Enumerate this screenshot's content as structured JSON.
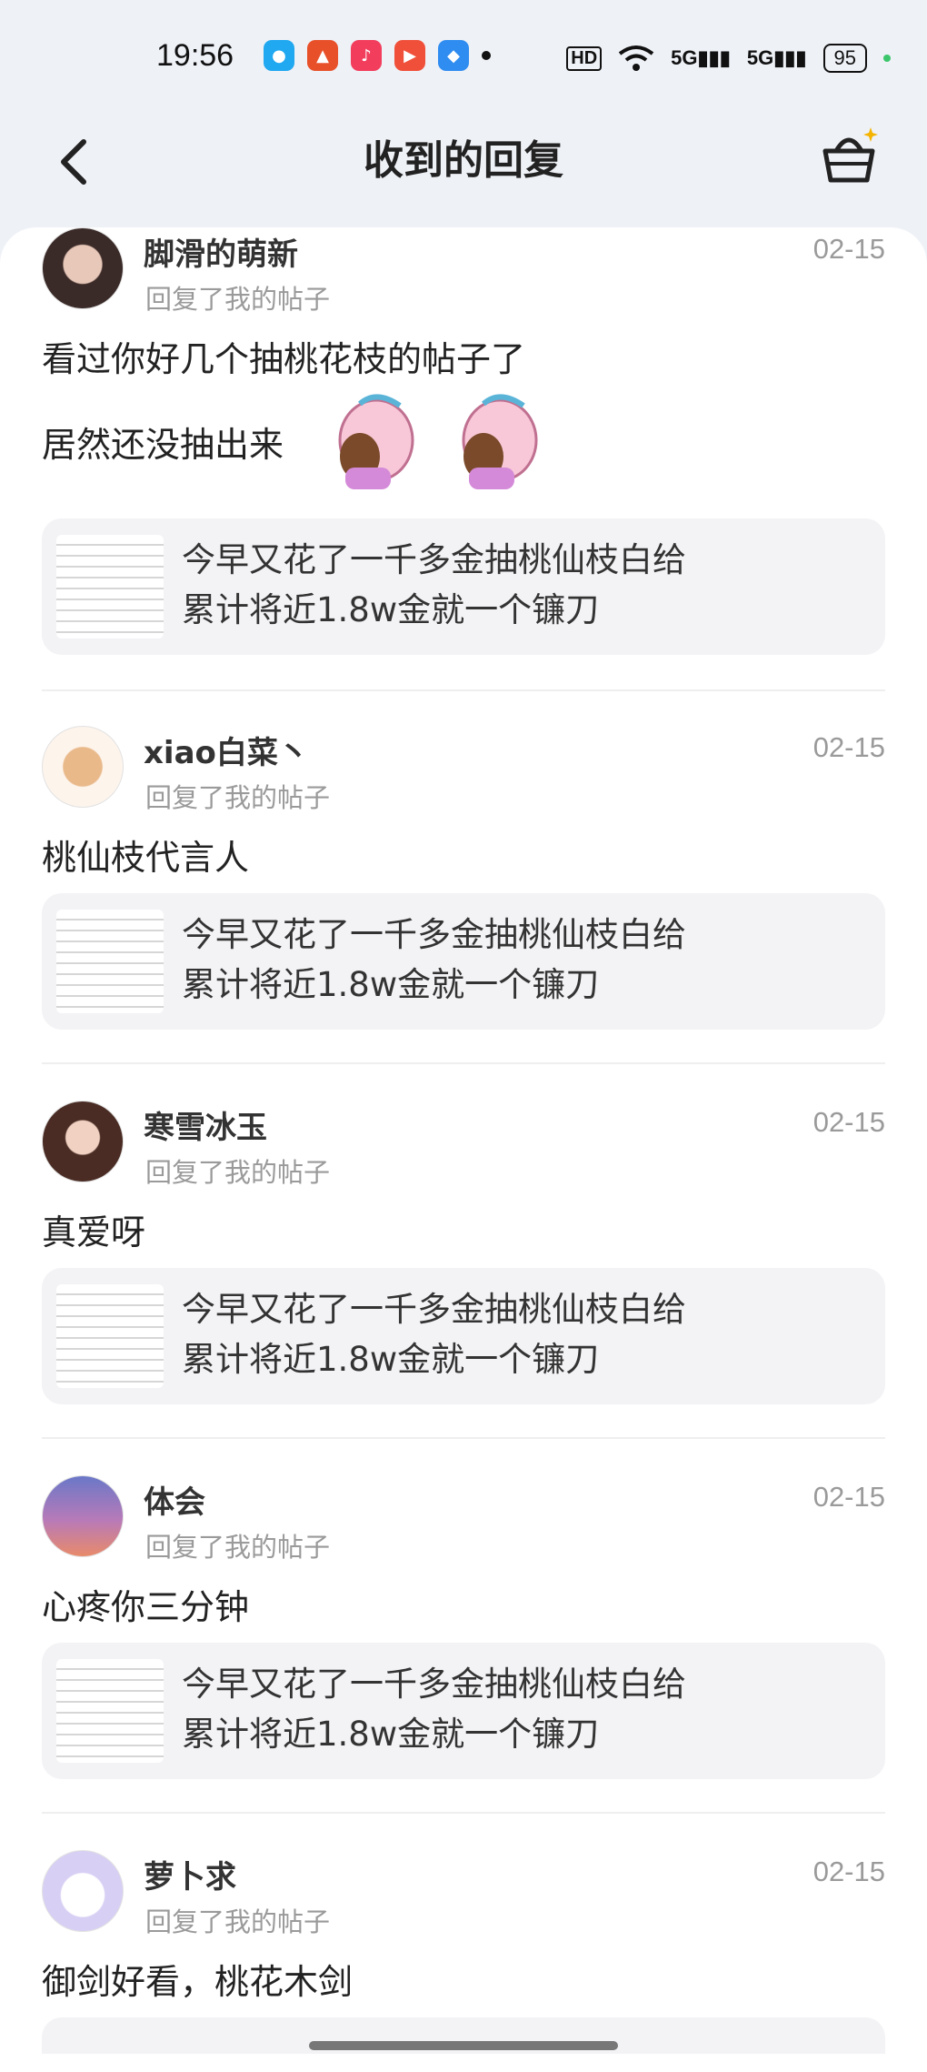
{
  "status": {
    "time": "19:56",
    "hd_label": "HD",
    "signal1": "5G",
    "signal2": "5G",
    "battery": "95"
  },
  "nav": {
    "title": "收到的回复"
  },
  "quote_line1": "今早又花了一千多金抽桃仙枝白给",
  "quote_line2": "累计将近1.8w金就一个镰刀",
  "replies": [
    {
      "name": "脚滑的萌新",
      "subtitle": "回复了我的帖子",
      "date": "02-15",
      "line1": "看过你好几个抽桃花枝的帖子了",
      "line2": "居然还没抽出来"
    },
    {
      "name": "xiao白菜丶",
      "subtitle": "回复了我的帖子",
      "date": "02-15",
      "line1": "桃仙枝代言人"
    },
    {
      "name": "寒雪冰玉",
      "subtitle": "回复了我的帖子",
      "date": "02-15",
      "line1": "真爱呀"
    },
    {
      "name": "体会",
      "subtitle": "回复了我的帖子",
      "date": "02-15",
      "line1": "心疼你三分钟"
    },
    {
      "name": "萝卜求",
      "subtitle": "回复了我的帖子",
      "date": "02-15",
      "line1": "御剑好看，桃花木剑"
    }
  ]
}
